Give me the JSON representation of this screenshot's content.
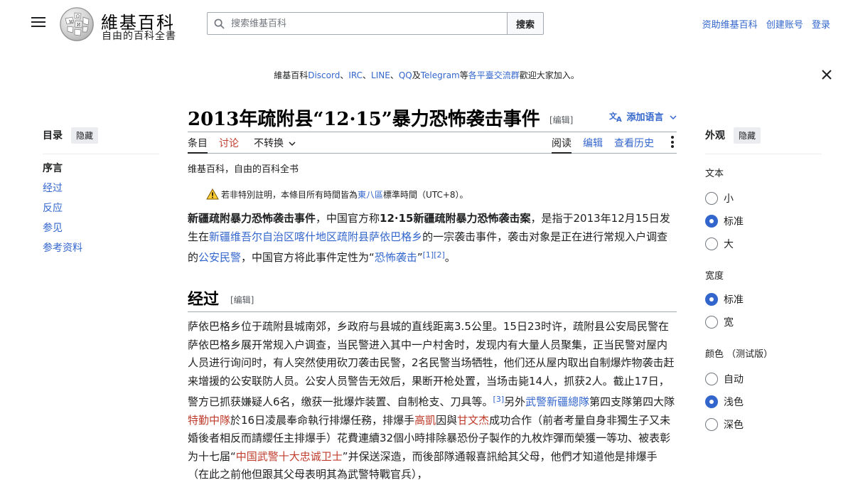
{
  "header": {
    "logo_word": "維基百科",
    "logo_tagline": "自由的百科全書",
    "search_placeholder": "搜索维基百科",
    "search_button": "搜索",
    "user_links": [
      "资助维基百科",
      "创建账号",
      "登录"
    ]
  },
  "banner": {
    "prefix": "維基百科",
    "discord": "Discord",
    "sep1": "、",
    "irc": "IRC",
    "sep2": "、",
    "line": "LINE",
    "sep3": "、",
    "qq": "QQ",
    "and": "及",
    "telegram": "Telegram",
    "etc": "等",
    "platforms": "各平臺交流群",
    "suffix": "歡迎大家加入。"
  },
  "toc": {
    "title": "目录",
    "hide": "隐藏",
    "items": [
      "序言",
      "经过",
      "反应",
      "参见",
      "参考资料"
    ]
  },
  "article": {
    "title": "2013年疏附县“12·15”暴力恐怖袭击事件",
    "edit": "[编辑]",
    "add_lang": "添加语言",
    "tabs": {
      "article": "条目",
      "talk": "讨论",
      "variant": "不转换",
      "read": "阅读",
      "edit": "编辑",
      "history": "查看历史"
    },
    "subtitle": "维基百科，自由的百科全书",
    "notice_pre": "若非特別註明，本條目所有時間皆為",
    "notice_link": "東八區",
    "notice_post": "標準時間（UTC+8）。",
    "lead": {
      "b1": "新疆疏附暴力恐怖袭击事件",
      "t1": "，中国官方称",
      "b2": "12·15新疆疏附暴力恐怖袭击案",
      "t2": "，是指于2013年12月15日发生在",
      "l1": "新疆维吾尔自治区",
      "l2": "喀什地区",
      "l3": "疏附县",
      "l4": "萨依巴格乡",
      "t3": "的一宗袭击事件，袭击对象是正在进行常规入户调查的",
      "l5": "公安民警",
      "t4": "，中国官方将此事件定性为“",
      "l6": "恐怖袭击",
      "t5": "”",
      "ref1": "[1]",
      "ref2": "[2]",
      "t6": "。"
    },
    "section_title": "经过",
    "section_edit": "[编辑]",
    "body": {
      "t1": "萨依巴格乡位于疏附县城南郊，乡政府与县城的直线距离3.5公里。15日23时许，疏附县公安局民警在萨依巴格乡展开常规入户调查，当民警进入其中一户村舍时，发现内有大量人员聚集，正当民警对屋内人员进行询问时，有人突然使用砍刀袭击民警，2名民警当场牺牲，他们还从屋内取出自制爆炸物袭击赶来增援的公安联防人员。公安人员警告无效后，果断开枪处置，当场击毙14人，抓获2人。截止17日，警方已抓获嫌疑人6名，缴获一批爆炸装置、自制枪支、刀具等。",
      "ref3": "[3]",
      "t2": "另外",
      "l1": "武警新疆總隊",
      "t3": "第四支隊第四大隊",
      "l2": "特勤中隊",
      "t4": "於16日凌晨奉命執行排爆任務，排爆手",
      "l3": "高凱",
      "t5": "因與",
      "l4": "甘文杰",
      "t6": "成功合作（前者考量自身非獨生子又未婚後者相反而請纓任主排爆手）花費連續32個小時排除暴恐份子製作的九枚炸彈而榮獲一等功、被表彰为十七届“",
      "l5": "中国武警十大忠诚卫士",
      "t7": "”并保送深造，而後部隊通報喜訊給其父母，他們才知道他是排爆手（在此之前他但跟其父母表明其為武警特戰官兵），"
    }
  },
  "appearance": {
    "title": "外观",
    "hide": "隐藏",
    "text_label": "文本",
    "text_options": [
      "小",
      "标准",
      "大"
    ],
    "width_label": "宽度",
    "width_options": [
      "标准",
      "宽"
    ],
    "color_label": "颜色 （测试版）",
    "color_options": [
      "自动",
      "浅色",
      "深色"
    ]
  }
}
